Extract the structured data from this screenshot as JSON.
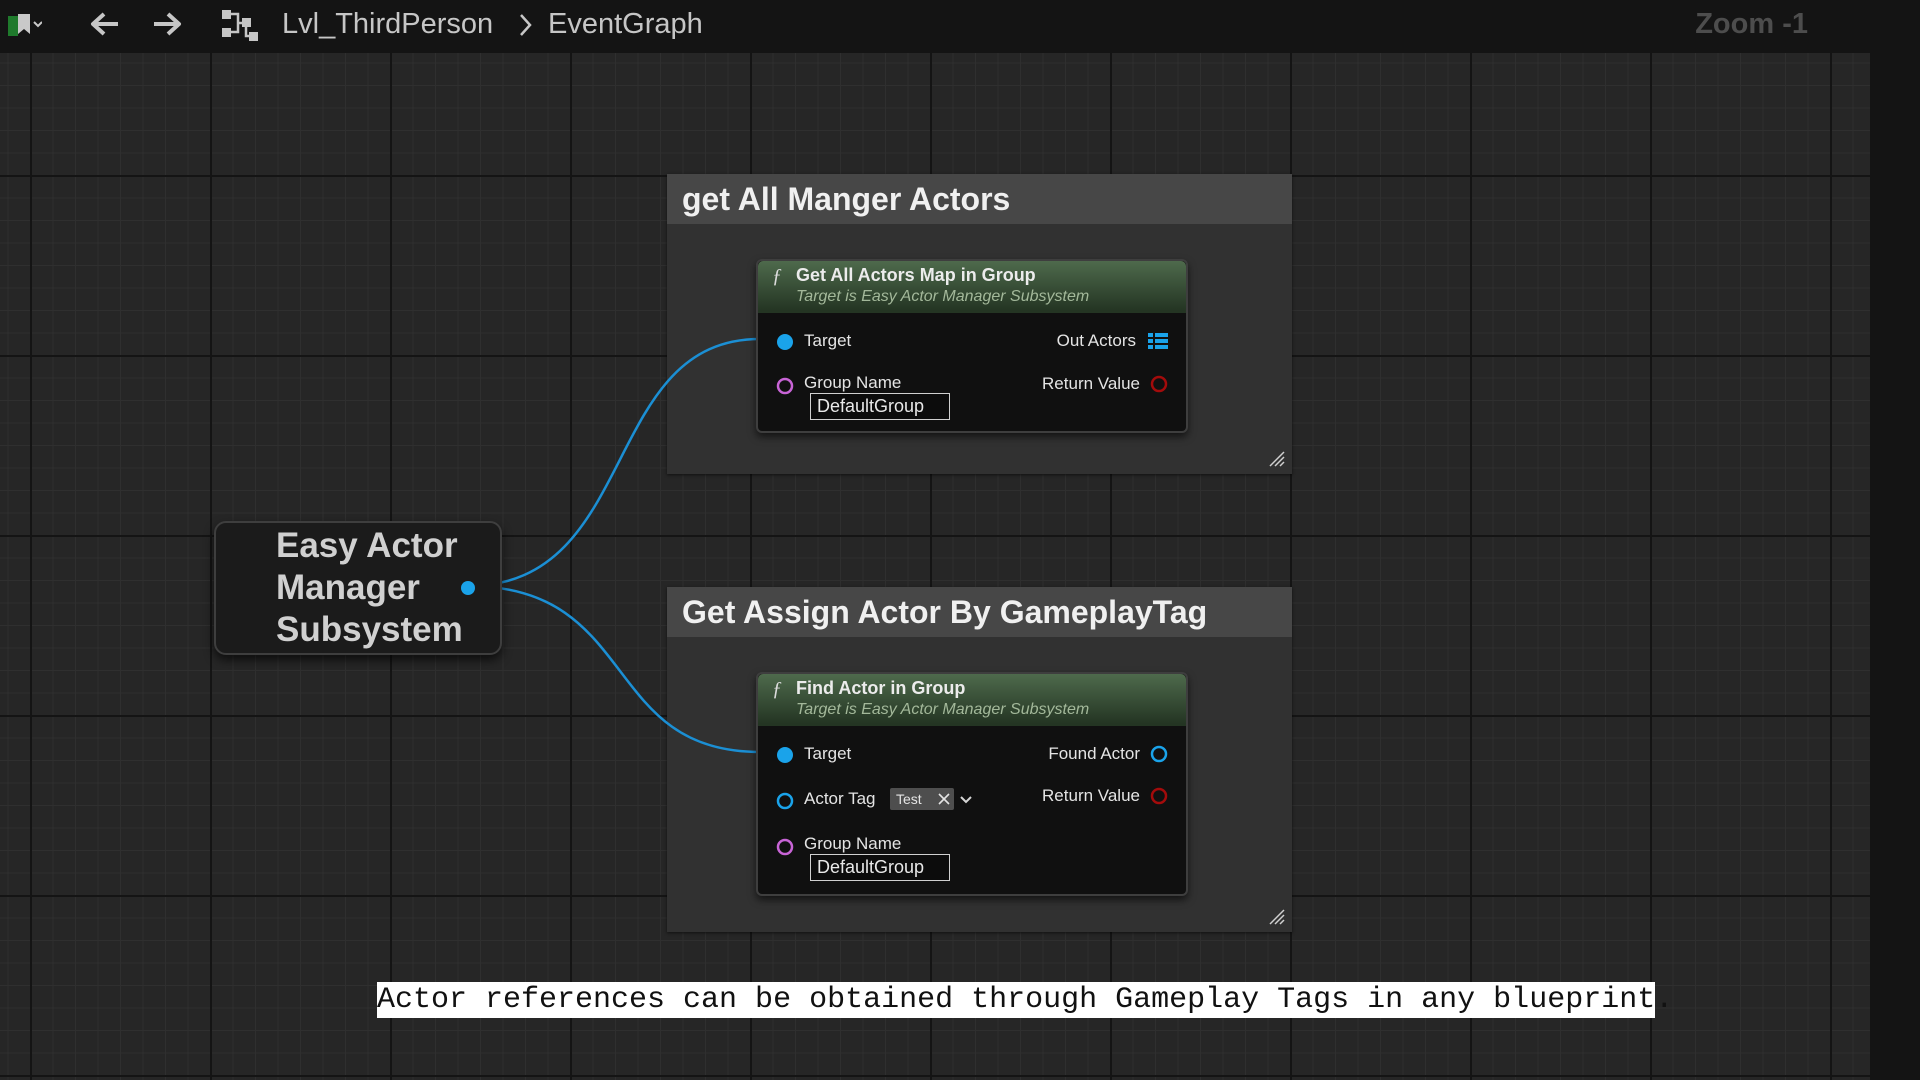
{
  "toolbar": {
    "breadcrumb": [
      "Lvl_ThirdPerson",
      "EventGraph"
    ],
    "zoom": "Zoom -1"
  },
  "getter_node": {
    "title": "Easy Actor Manager Subsystem"
  },
  "comments": [
    {
      "title": "get All Manger Actors",
      "node": {
        "title": "Get All Actors Map in Group",
        "subtitle": "Target is Easy Actor Manager Subsystem",
        "inputs": {
          "target": "Target",
          "group_name": "Group Name",
          "group_value": "DefaultGroup"
        },
        "outputs": {
          "out_actors": "Out Actors",
          "return_value": "Return Value"
        }
      }
    },
    {
      "title": "Get Assign Actor By GameplayTag",
      "node": {
        "title": "Find Actor in Group",
        "subtitle": "Target is Easy Actor Manager Subsystem",
        "inputs": {
          "target": "Target",
          "actor_tag": "Actor Tag",
          "tag_value": "Test",
          "group_name": "Group Name",
          "group_value": "DefaultGroup"
        },
        "outputs": {
          "found_actor": "Found Actor",
          "return_value": "Return Value"
        }
      }
    }
  ],
  "caption": "Actor references can be obtained through Gameplay Tags in any blueprint.",
  "colors": {
    "object_pin": "#0fa0e8",
    "name_pin": "#c864d6",
    "bool_pin": "#a30b0b",
    "node_header": "#4e6a4c"
  }
}
